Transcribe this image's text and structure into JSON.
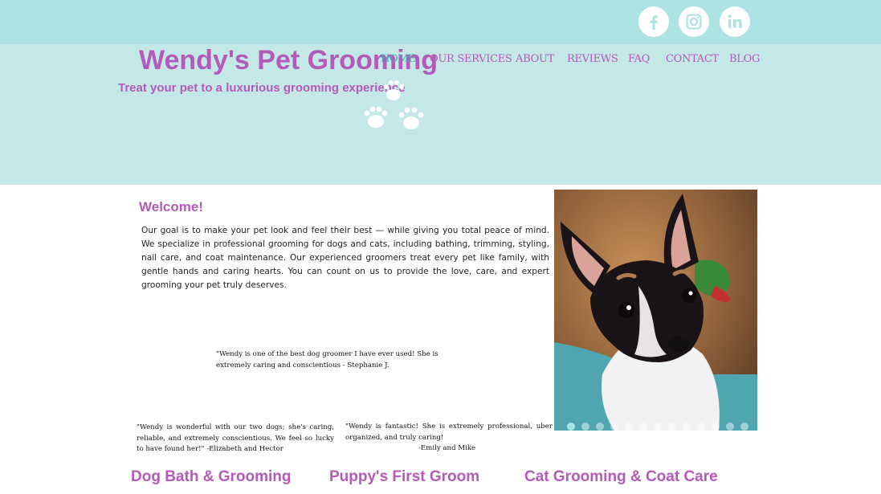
{
  "site": {
    "brand": "Wendy's Pet Grooming",
    "tagline": "Treat your pet to a luxurious grooming experience"
  },
  "social": {
    "items": [
      {
        "name": "facebook-icon"
      },
      {
        "name": "instagram-icon"
      },
      {
        "name": "linkedin-icon"
      }
    ]
  },
  "nav": {
    "items": [
      {
        "label": "HOME",
        "active": true
      },
      {
        "label": "OUR SERVICES"
      },
      {
        "label": "ABOUT"
      },
      {
        "label": "REVIEWS"
      },
      {
        "label": "FAQ"
      },
      {
        "label": "CONTACT"
      },
      {
        "label": "BLOG"
      }
    ]
  },
  "welcome": {
    "heading": "Welcome!",
    "body": "Our goal is to make your pet look and feel their best — while giving you total peace of mind. We specialize in professional grooming for dogs and cats, including bathing, trimming, styling, nail care, and coat maintenance. Our experienced groomers treat every pet like family, with gentle hands and caring hearts. You can count on us to provide the love, care, and expert grooming your pet truly deserves."
  },
  "testimonials": [
    {
      "text": "\"Wendy is one of the best dog groomer I have ever used!   She is extremely caring and conscientious   - Stephanie J."
    },
    {
      "text": "\"Wendy is wonderful with our two dogs; she's caring, reliable, and extremely conscientious. We feel so lucky to have found her!\" -Elizabeth and Hector"
    },
    {
      "text": "\"Wendy is fantastic! She is extremely professional, uber organized, and truly caring!",
      "signature": "-Emily and Mike"
    }
  ],
  "slider": {
    "slide_count": 13,
    "active_index": 0
  },
  "services": [
    {
      "title": "Dog Bath & Grooming"
    },
    {
      "title": "Puppy's First Groom"
    },
    {
      "title": "Cat Grooming & Coat Care"
    }
  ],
  "colors": {
    "accent": "#b45ab8",
    "topbar": "#ade3e3",
    "header": "#c4e8e8",
    "nav_active": "#4aaeb6"
  }
}
